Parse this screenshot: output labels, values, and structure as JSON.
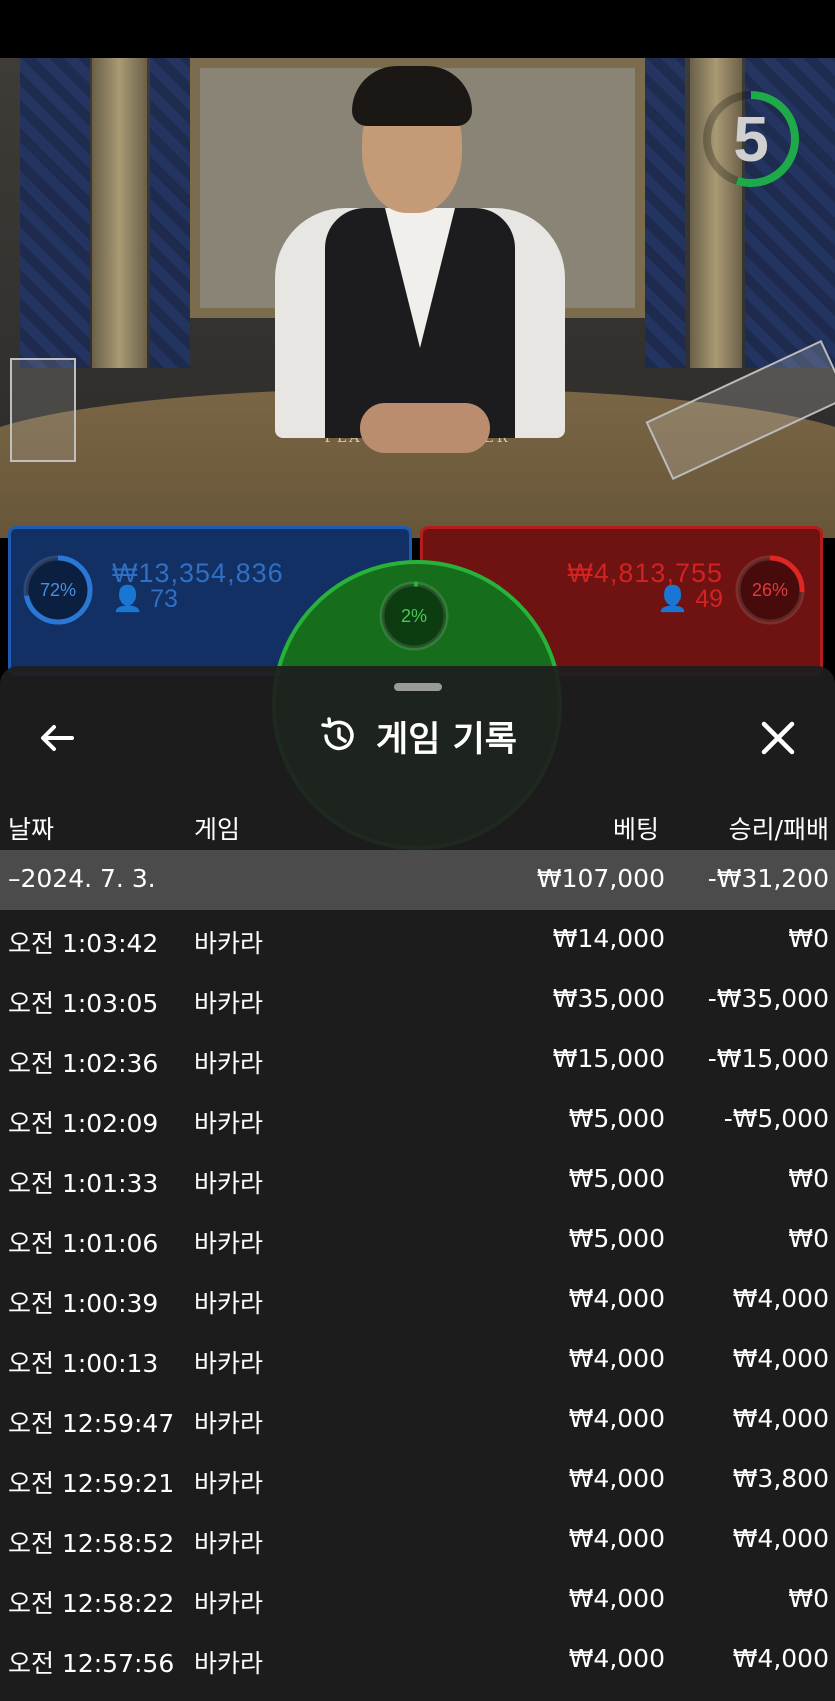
{
  "timer": {
    "value": "5",
    "progress": 0.55,
    "color": "#1faa4a"
  },
  "bets": {
    "player": {
      "percent": "72%",
      "percent_value": 0.72,
      "amount": "₩13,354,836",
      "count": "73",
      "color": "#2a78d6"
    },
    "banker": {
      "percent": "26%",
      "percent_value": 0.26,
      "amount": "₩4,813,755",
      "count": "49",
      "color": "#e02525"
    },
    "tie": {
      "percent": "2%",
      "percent_value": 0.02,
      "color": "#27b33a"
    }
  },
  "table_text": "PLAYER ⬥ BANKER",
  "sheet": {
    "title": "게임 기록",
    "back_icon": "arrow-left-icon",
    "history_icon": "history-clock-icon",
    "close_icon": "close-icon",
    "columns": {
      "date": "날짜",
      "game": "게임",
      "bet": "베팅",
      "result": "승리/패배"
    },
    "summary": {
      "date": "–2024. 7. 3.",
      "bet": "₩107,000",
      "result": "-₩31,200"
    },
    "rows": [
      {
        "time": "오전 1:03:42",
        "game": "바카라",
        "bet": "₩14,000",
        "result": "₩0"
      },
      {
        "time": "오전 1:03:05",
        "game": "바카라",
        "bet": "₩35,000",
        "result": "-₩35,000"
      },
      {
        "time": "오전 1:02:36",
        "game": "바카라",
        "bet": "₩15,000",
        "result": "-₩15,000"
      },
      {
        "time": "오전 1:02:09",
        "game": "바카라",
        "bet": "₩5,000",
        "result": "-₩5,000"
      },
      {
        "time": "오전 1:01:33",
        "game": "바카라",
        "bet": "₩5,000",
        "result": "₩0"
      },
      {
        "time": "오전 1:01:06",
        "game": "바카라",
        "bet": "₩5,000",
        "result": "₩0"
      },
      {
        "time": "오전 1:00:39",
        "game": "바카라",
        "bet": "₩4,000",
        "result": "₩4,000"
      },
      {
        "time": "오전 1:00:13",
        "game": "바카라",
        "bet": "₩4,000",
        "result": "₩4,000"
      },
      {
        "time": "오전 12:59:47",
        "game": "바카라",
        "bet": "₩4,000",
        "result": "₩4,000"
      },
      {
        "time": "오전 12:59:21",
        "game": "바카라",
        "bet": "₩4,000",
        "result": "₩3,800"
      },
      {
        "time": "오전 12:58:52",
        "game": "바카라",
        "bet": "₩4,000",
        "result": "₩4,000"
      },
      {
        "time": "오전 12:58:22",
        "game": "바카라",
        "bet": "₩4,000",
        "result": "₩0"
      },
      {
        "time": "오전 12:57:56",
        "game": "바카라",
        "bet": "₩4,000",
        "result": "₩4,000"
      }
    ]
  }
}
